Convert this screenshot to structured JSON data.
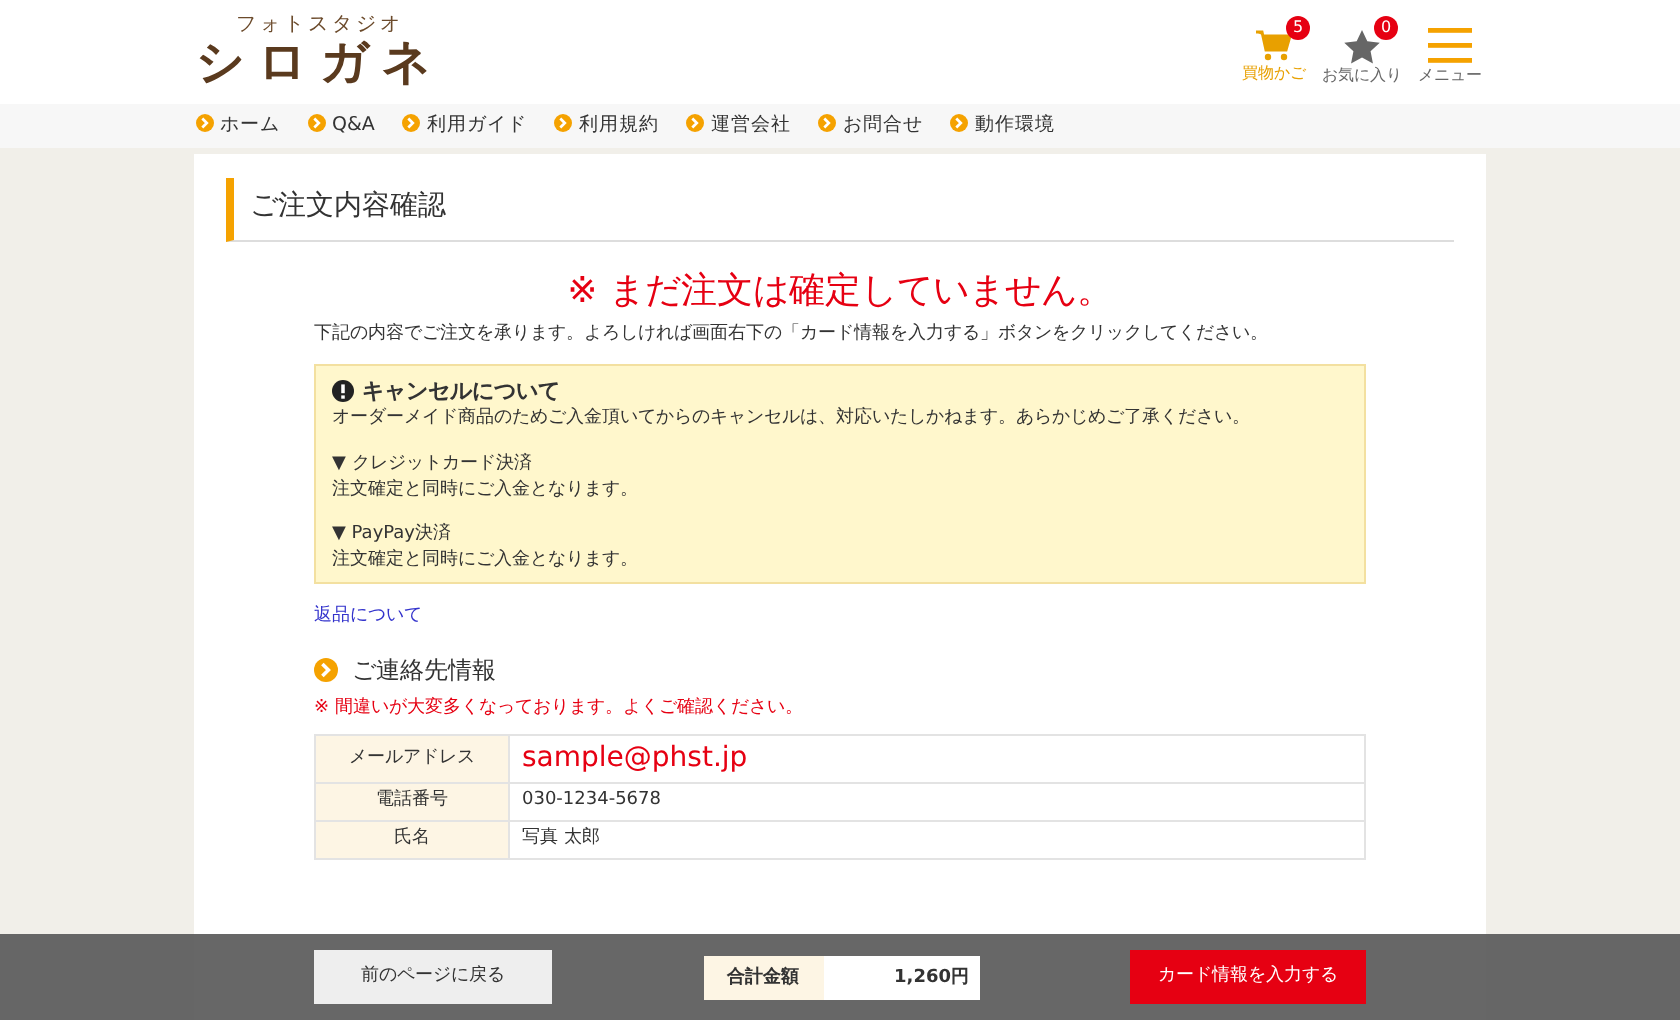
{
  "header": {
    "logo_caption": "フォトスタジオ",
    "logo": "シロガネ",
    "icons": [
      {
        "kind": "cart",
        "label": "買物かご",
        "count": "5",
        "selected": true
      },
      {
        "kind": "star",
        "label": "お気に入り",
        "count": "0",
        "selected": false
      },
      {
        "kind": "menu",
        "label": "メニュー",
        "selected": false
      }
    ]
  },
  "nav": [
    "ホーム",
    "Q&A",
    "利用ガイド",
    "利用規約",
    "運営会社",
    "お問合せ",
    "動作環境"
  ],
  "page_title": "ご注文内容確認",
  "warning": "※ まだ注文は確定していません。",
  "intro": "下記の内容でご注文を承ります。よろしければ画面右下の「カード情報を入力する」ボタンをクリックしてください。",
  "notice": {
    "title": "キャンセルについて",
    "paragraphs": [
      [
        "オーダーメイド商品のためご入金頂いてからのキャンセルは、対応いたしかねます。あらかじめご了承ください。"
      ],
      [
        "▼ クレジットカード決済",
        "注文確定と同時にご入金となります。"
      ],
      [
        "▼ PayPay決済",
        "注文確定と同時にご入金となります。"
      ]
    ]
  },
  "returns_link": "返品について",
  "contact": {
    "heading": "ご連絡先情報",
    "caution": "※  間違いが大変多くなっております。よくご確認ください。",
    "rows": [
      {
        "label": "メールアドレス",
        "value": "sample@phst.jp",
        "emphasis": true
      },
      {
        "label": "電話番号",
        "value": "030-1234-5678",
        "emphasis": false
      },
      {
        "label": "氏名",
        "value": "写真 太郎",
        "emphasis": false
      }
    ]
  },
  "footer_bar": {
    "back_button": "前のページに戻る",
    "total_label": "合計金額",
    "total_value": "1,260円",
    "submit_button": "カード情報を入力する"
  }
}
